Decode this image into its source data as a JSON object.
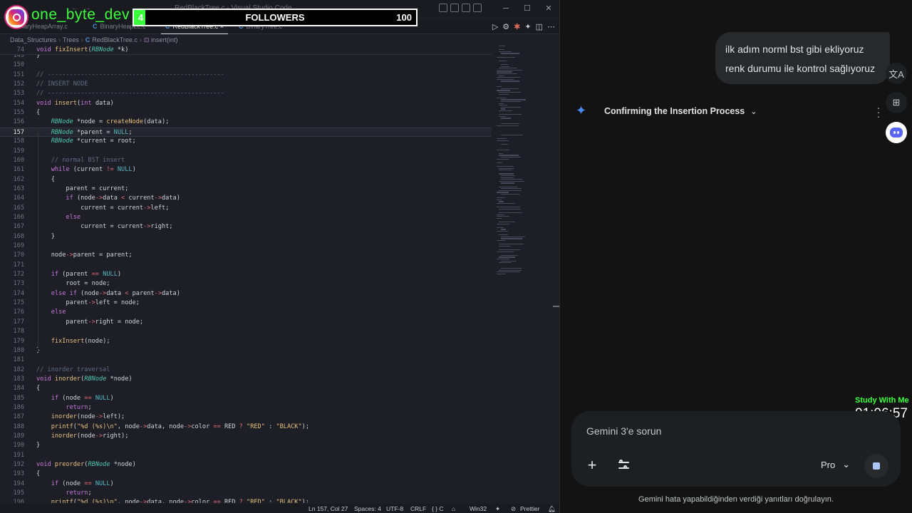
{
  "overlay": {
    "instagram_handle": "one_byte_dev",
    "followers": {
      "count": "4",
      "label": "FOLLOWERS",
      "goal": "100",
      "progress": 0.04
    },
    "study_label": "Study With Me",
    "study_timer": "01:06:57"
  },
  "vscode": {
    "window_title": "RedBlackTree.c - Visual Studio Code",
    "tabs": [
      {
        "label": "BinaryHeapArray.c",
        "active": false
      },
      {
        "label": "BinaryHeapLL.c",
        "active": false
      },
      {
        "label": "RedBlackTree.c",
        "active": true,
        "close": "×"
      },
      {
        "label": "BinaryTree.c",
        "active": false
      }
    ],
    "breadcrumb": [
      "Data_Structures",
      "Trees",
      "RedBlackTree.c",
      "insert(int)"
    ],
    "sticky_line": {
      "number": "74",
      "code": "void fixInsert(RBNode *k)"
    },
    "current_line": "157",
    "lines": [
      {
        "n": "149",
        "t": "}"
      },
      {
        "n": "150",
        "t": ""
      },
      {
        "n": "151",
        "t": "// ------------------------------------------------"
      },
      {
        "n": "152",
        "t": "// INSERT NODE"
      },
      {
        "n": "153",
        "t": "// ------------------------------------------------"
      },
      {
        "n": "154",
        "t": "void insert(int data)"
      },
      {
        "n": "155",
        "t": "{"
      },
      {
        "n": "156",
        "t": "    RBNode *node = createNode(data);"
      },
      {
        "n": "157",
        "t": "    RBNode *parent = NULL;"
      },
      {
        "n": "158",
        "t": "    RBNode *current = root;"
      },
      {
        "n": "159",
        "t": ""
      },
      {
        "n": "160",
        "t": "    // normal BST insert"
      },
      {
        "n": "161",
        "t": "    while (current != NULL)"
      },
      {
        "n": "162",
        "t": "    {"
      },
      {
        "n": "163",
        "t": "        parent = current;"
      },
      {
        "n": "164",
        "t": "        if (node->data < current->data)"
      },
      {
        "n": "165",
        "t": "            current = current->left;"
      },
      {
        "n": "166",
        "t": "        else"
      },
      {
        "n": "167",
        "t": "            current = current->right;"
      },
      {
        "n": "168",
        "t": "    }"
      },
      {
        "n": "169",
        "t": ""
      },
      {
        "n": "170",
        "t": "    node->parent = parent;"
      },
      {
        "n": "171",
        "t": ""
      },
      {
        "n": "172",
        "t": "    if (parent == NULL)"
      },
      {
        "n": "173",
        "t": "        root = node;"
      },
      {
        "n": "174",
        "t": "    else if (node->data < parent->data)"
      },
      {
        "n": "175",
        "t": "        parent->left = node;"
      },
      {
        "n": "176",
        "t": "    else"
      },
      {
        "n": "177",
        "t": "        parent->right = node;"
      },
      {
        "n": "178",
        "t": ""
      },
      {
        "n": "179",
        "t": "    fixInsert(node);"
      },
      {
        "n": "180",
        "t": "}"
      },
      {
        "n": "181",
        "t": ""
      },
      {
        "n": "182",
        "t": "// inorder traversal"
      },
      {
        "n": "183",
        "t": "void inorder(RBNode *node)"
      },
      {
        "n": "184",
        "t": "{"
      },
      {
        "n": "185",
        "t": "    if (node == NULL)"
      },
      {
        "n": "186",
        "t": "        return;"
      },
      {
        "n": "187",
        "t": "    inorder(node->left);"
      },
      {
        "n": "188",
        "t": "    printf(\"%d (%s)\\n\", node->data, node->color == RED ? \"RED\" : \"BLACK\");"
      },
      {
        "n": "189",
        "t": "    inorder(node->right);"
      },
      {
        "n": "190",
        "t": "}"
      },
      {
        "n": "191",
        "t": ""
      },
      {
        "n": "192",
        "t": "void preorder(RBNode *node)"
      },
      {
        "n": "193",
        "t": "{"
      },
      {
        "n": "194",
        "t": "    if (node == NULL)"
      },
      {
        "n": "195",
        "t": "        return;"
      },
      {
        "n": "196",
        "t": "    printf(\"%d (%s)\\n\", node->data, node->color == RED ? \"RED\" : \"BLACK\");"
      }
    ],
    "status": {
      "position": "Ln 157, Col 27",
      "spaces": "Spaces: 4",
      "encoding": "UTF-8",
      "eol": "CRLF",
      "language": "{ } C",
      "platform": "Win32",
      "prettier": "Prettier"
    }
  },
  "gemini": {
    "user_message_line1": "ilk adım norml bst gibi ekliyoruz",
    "user_message_line2": "renk durumu ile kontrol sağlıyoruz",
    "response_title": "Confirming the Insertion Process",
    "input_placeholder": "Gemini 3'e sorun",
    "mode": "Pro",
    "disclaimer": "Gemini hata yapabildiğinden verdiği yanıtları doğrulayın.",
    "accent_color": "#4a8cf7"
  }
}
